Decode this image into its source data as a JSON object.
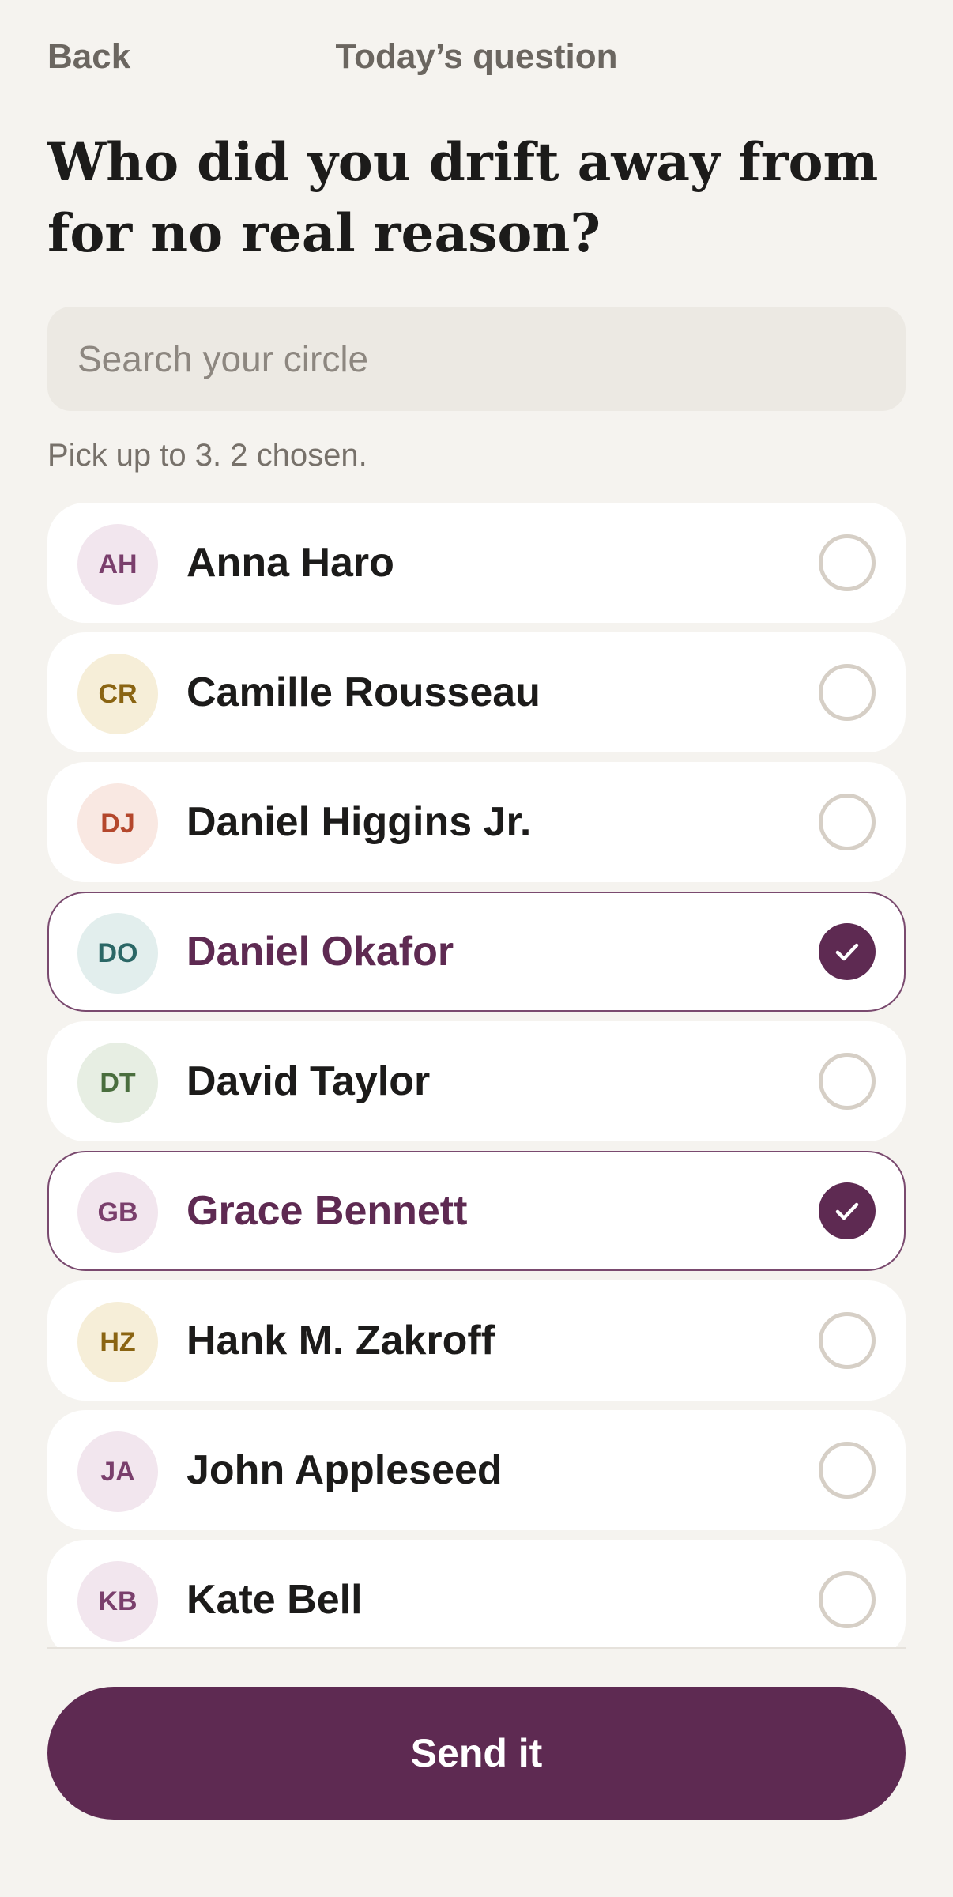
{
  "header": {
    "back_label": "Back",
    "title": "Today’s question"
  },
  "question": "Who did you drift away from for no real reason?",
  "search": {
    "placeholder": "Search your circle",
    "value": ""
  },
  "hint": "Pick up to 3. 2 chosen.",
  "contacts": [
    {
      "initials": "AH",
      "name": "Anna Haro",
      "selected": false,
      "avatar_bg": "#f2e6ee",
      "avatar_fg": "#7a3f6c"
    },
    {
      "initials": "CR",
      "name": "Camille Rousseau",
      "selected": false,
      "avatar_bg": "#f6eed8",
      "avatar_fg": "#8a6412"
    },
    {
      "initials": "DJ",
      "name": "Daniel Higgins Jr.",
      "selected": false,
      "avatar_bg": "#f9e8e2",
      "avatar_fg": "#b4472c"
    },
    {
      "initials": "DO",
      "name": "Daniel Okafor",
      "selected": true,
      "avatar_bg": "#e2eeed",
      "avatar_fg": "#2b6766"
    },
    {
      "initials": "DT",
      "name": "David Taylor",
      "selected": false,
      "avatar_bg": "#e7eee3",
      "avatar_fg": "#4a6e3e"
    },
    {
      "initials": "GB",
      "name": "Grace Bennett",
      "selected": true,
      "avatar_bg": "#f2e6ee",
      "avatar_fg": "#7a3f6c"
    },
    {
      "initials": "HZ",
      "name": "Hank M. Zakroff",
      "selected": false,
      "avatar_bg": "#f6eed8",
      "avatar_fg": "#8a6412"
    },
    {
      "initials": "JA",
      "name": "John Appleseed",
      "selected": false,
      "avatar_bg": "#f2e6ee",
      "avatar_fg": "#7a3f6c"
    },
    {
      "initials": "KB",
      "name": "Kate Bell",
      "selected": false,
      "avatar_bg": "#f2e6ee",
      "avatar_fg": "#7a3f6c"
    }
  ],
  "icons": {
    "check": "checkmark-icon",
    "radio": "radio-circle-icon"
  },
  "colors": {
    "accent": "#5e2a52",
    "background": "#f5f3ef",
    "card": "#ffffff"
  },
  "send_label": "Send it"
}
